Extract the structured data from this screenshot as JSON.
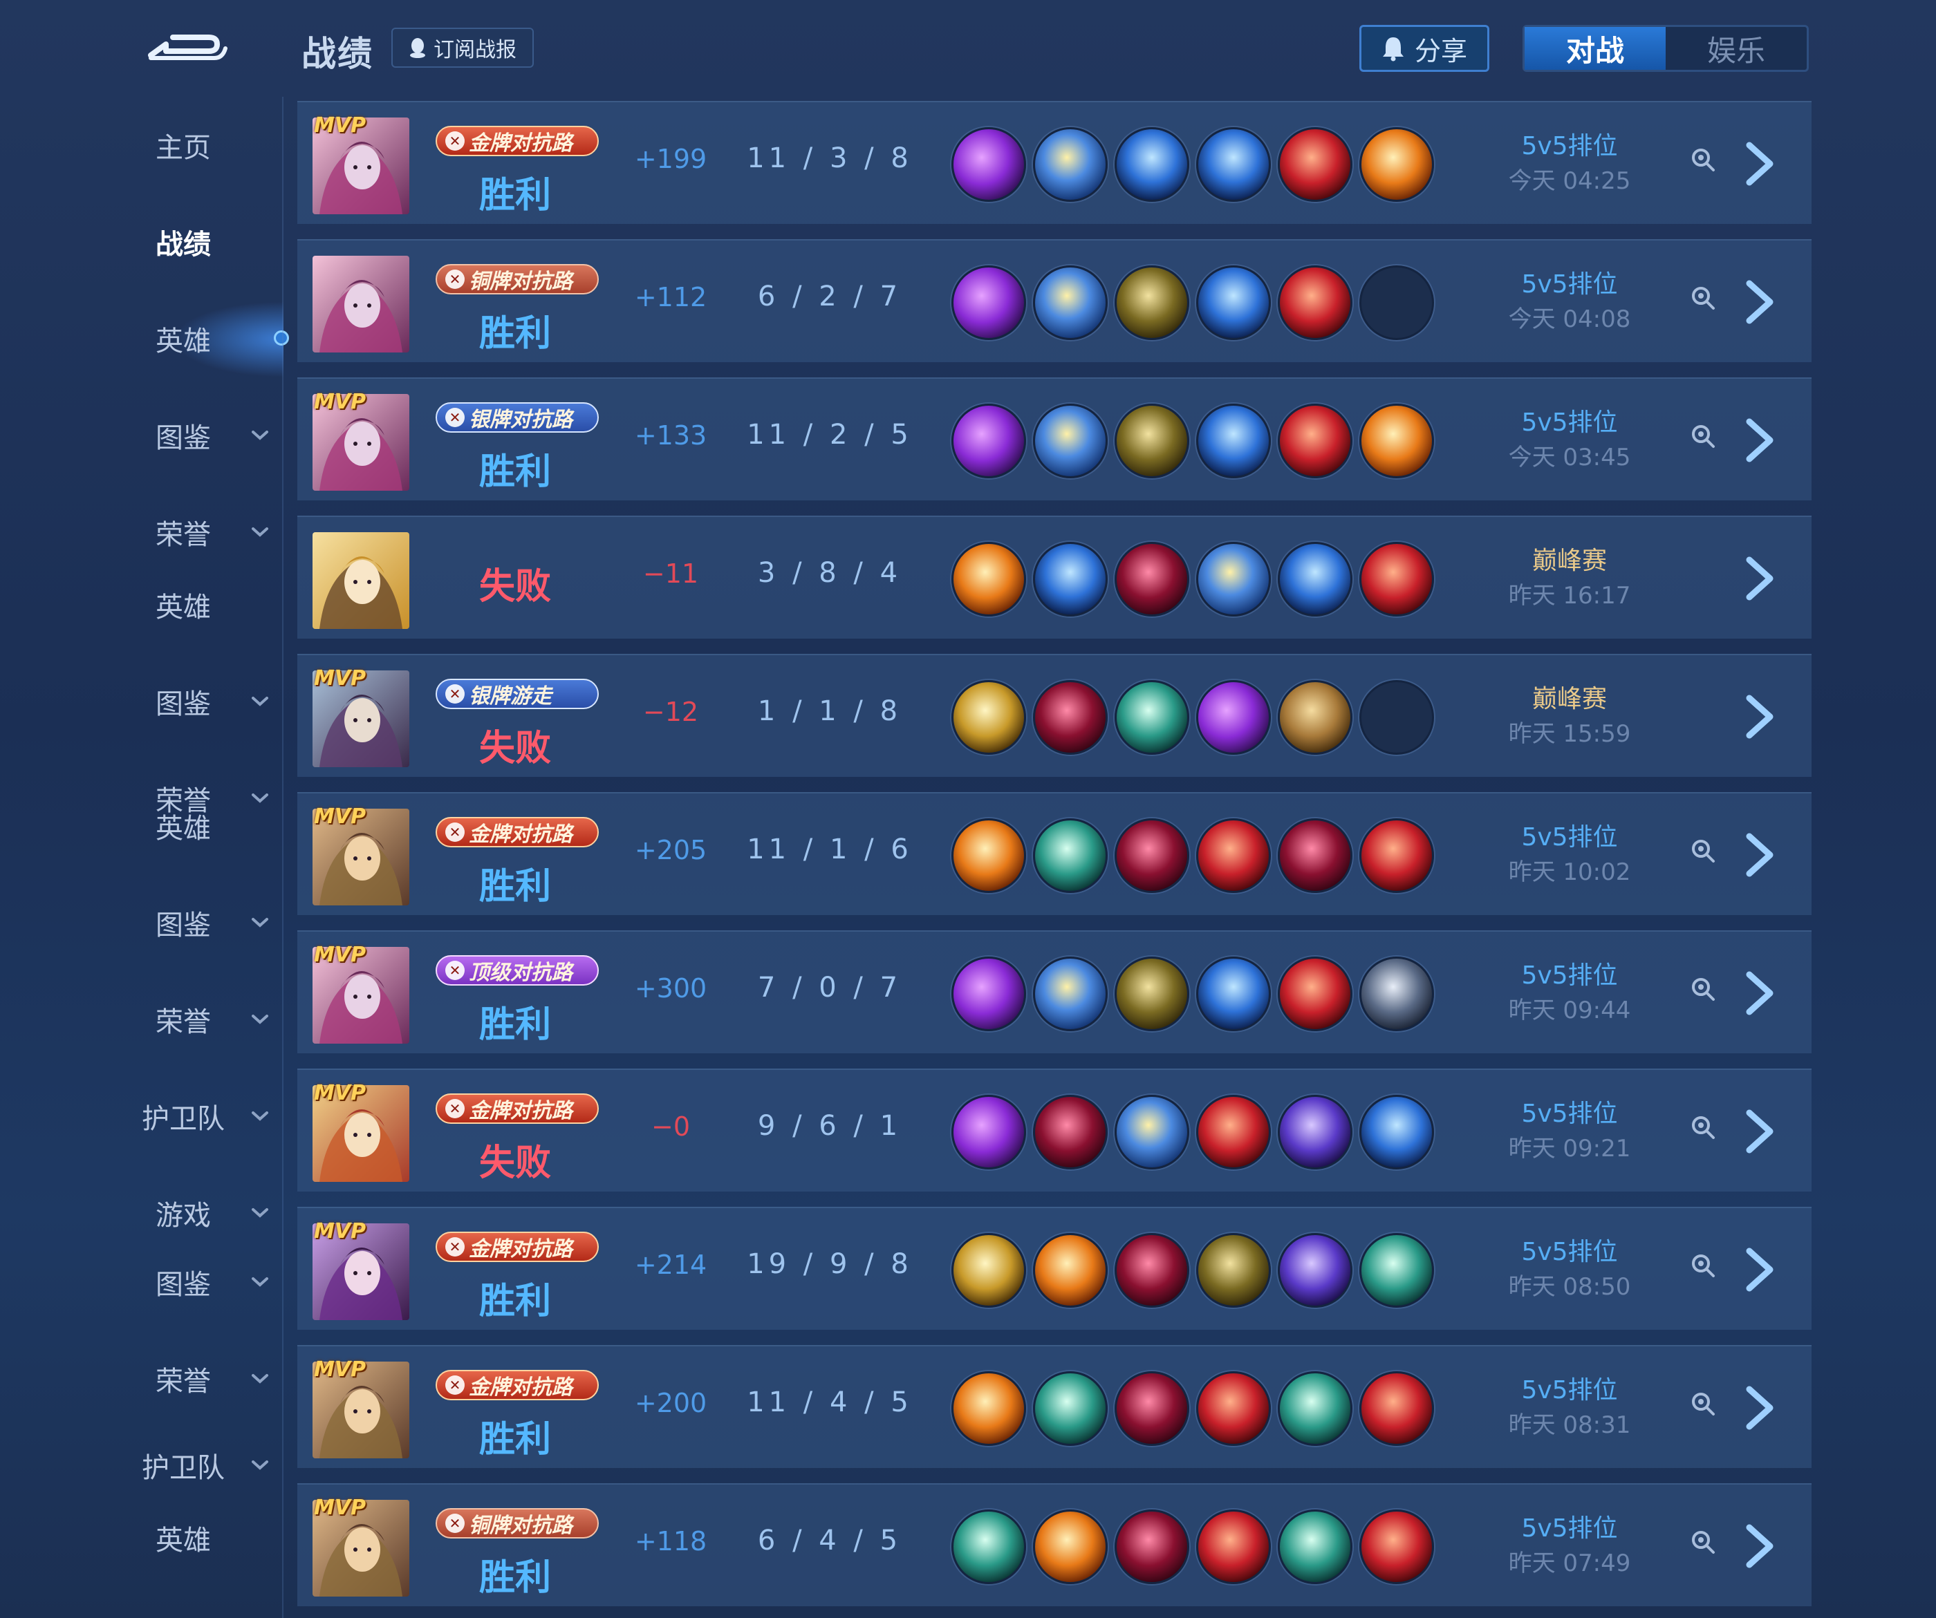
{
  "header": {
    "title": "战绩",
    "subscribe_label": "订阅战报",
    "share_label": "分享",
    "tabs": [
      {
        "label": "对战",
        "active": true
      },
      {
        "label": "娱乐",
        "active": false
      }
    ]
  },
  "sidebar": {
    "items": [
      {
        "label": "主页",
        "chevron": false,
        "active": false
      },
      {
        "label": "战绩",
        "chevron": false,
        "active": true
      },
      {
        "label": "英雄",
        "chevron": false,
        "active": false
      },
      {
        "label": "图鉴",
        "chevron": true,
        "active": false
      },
      {
        "label": "荣誉",
        "chevron": true,
        "active": false
      },
      {
        "label": "英雄",
        "chevron": false,
        "active": false
      },
      {
        "label": "图鉴",
        "chevron": true,
        "active": false
      },
      {
        "label": "荣誉",
        "chevron": true,
        "active": false
      },
      {
        "label": "英雄",
        "chevron": false,
        "active": false
      },
      {
        "label": "图鉴",
        "chevron": true,
        "active": false
      },
      {
        "label": "荣誉",
        "chevron": true,
        "active": false
      },
      {
        "label": "护卫队",
        "chevron": true,
        "active": false
      },
      {
        "label": "游戏",
        "chevron": true,
        "active": false
      },
      {
        "label": "图鉴",
        "chevron": true,
        "active": false
      },
      {
        "label": "荣誉",
        "chevron": true,
        "active": false
      },
      {
        "label": "护卫队",
        "chevron": true,
        "active": false
      },
      {
        "label": "英雄",
        "chevron": false,
        "active": false
      }
    ]
  },
  "matches": [
    {
      "mvp": true,
      "hero": "h1",
      "badge": "金牌对抗路",
      "badge_tier": "gold",
      "result": "胜利",
      "win": true,
      "delta": "+199",
      "kda": "11 / 3 / 8",
      "items": [
        "p-purple",
        "p-blue",
        "p-blue2",
        "p-blue2",
        "p-red",
        "p-orange"
      ],
      "mode": "5v5排位",
      "time": "今天 04:25",
      "spectate": true
    },
    {
      "mvp": false,
      "hero": "h1",
      "badge": "铜牌对抗路",
      "badge_tier": "copper",
      "result": "胜利",
      "win": true,
      "delta": "+112",
      "kda": "6 / 2 / 7",
      "items": [
        "p-purple",
        "p-blue",
        "p-green",
        "p-blue2",
        "p-red",
        "empty"
      ],
      "mode": "5v5排位",
      "time": "今天 04:08",
      "spectate": true
    },
    {
      "mvp": true,
      "hero": "h1",
      "badge": "银牌对抗路",
      "badge_tier": "silver",
      "result": "胜利",
      "win": true,
      "delta": "+133",
      "kda": "11 / 2 / 5",
      "items": [
        "p-purple",
        "p-blue",
        "p-green",
        "p-blue2",
        "p-red",
        "p-orange"
      ],
      "mode": "5v5排位",
      "time": "今天 03:45",
      "spectate": true
    },
    {
      "mvp": false,
      "hero": "h2",
      "badge": "",
      "badge_tier": "",
      "result": "失败",
      "win": false,
      "delta": "−11",
      "kda": "3 / 8 / 4",
      "items": [
        "p-orange",
        "p-blue2",
        "p-crimson",
        "p-blue",
        "p-blue2",
        "p-red"
      ],
      "mode": "巅峰赛",
      "time": "昨天 16:17",
      "spectate": false
    },
    {
      "mvp": true,
      "hero": "h3",
      "badge": "银牌游走",
      "badge_tier": "silver",
      "result": "失败",
      "win": false,
      "delta": "−12",
      "kda": "1 / 1 / 8",
      "items": [
        "p-gold",
        "p-crimson",
        "p-teal",
        "p-purple",
        "p-wood",
        "empty"
      ],
      "mode": "巅峰赛",
      "time": "昨天 15:59",
      "spectate": false
    },
    {
      "mvp": true,
      "hero": "h4",
      "badge": "金牌对抗路",
      "badge_tier": "gold",
      "result": "胜利",
      "win": true,
      "delta": "+205",
      "kda": "11 / 1 / 6",
      "items": [
        "p-orange",
        "p-teal",
        "p-crimson",
        "p-red",
        "p-crimson",
        "p-red"
      ],
      "mode": "5v5排位",
      "time": "昨天 10:02",
      "spectate": true
    },
    {
      "mvp": true,
      "hero": "h1",
      "badge": "顶级对抗路",
      "badge_tier": "top",
      "result": "胜利",
      "win": true,
      "delta": "+300",
      "kda": "7 / 0 / 7",
      "items": [
        "p-purple",
        "p-blue",
        "p-green",
        "p-blue2",
        "p-red",
        "p-steel"
      ],
      "mode": "5v5排位",
      "time": "昨天 09:44",
      "spectate": true
    },
    {
      "mvp": true,
      "hero": "h5",
      "badge": "金牌对抗路",
      "badge_tier": "gold",
      "result": "失败",
      "win": false,
      "delta": "−0",
      "kda": "9 / 6 / 1",
      "items": [
        "p-purple",
        "p-crimson",
        "p-blue",
        "p-red",
        "p-violet",
        "p-blue2"
      ],
      "mode": "5v5排位",
      "time": "昨天 09:21",
      "spectate": true
    },
    {
      "mvp": true,
      "hero": "h6",
      "badge": "金牌对抗路",
      "badge_tier": "gold",
      "result": "胜利",
      "win": true,
      "delta": "+214",
      "kda": "19 / 9 / 8",
      "items": [
        "p-gold",
        "p-orange",
        "p-crimson",
        "p-green",
        "p-violet",
        "p-teal"
      ],
      "mode": "5v5排位",
      "time": "昨天 08:50",
      "spectate": true
    },
    {
      "mvp": true,
      "hero": "h4",
      "badge": "金牌对抗路",
      "badge_tier": "gold",
      "result": "胜利",
      "win": true,
      "delta": "+200",
      "kda": "11 / 4 / 5",
      "items": [
        "p-orange",
        "p-teal",
        "p-crimson",
        "p-red",
        "p-teal",
        "p-red"
      ],
      "mode": "5v5排位",
      "time": "昨天 08:31",
      "spectate": true
    },
    {
      "mvp": true,
      "hero": "h4",
      "badge": "铜牌对抗路",
      "badge_tier": "copper",
      "result": "胜利",
      "win": true,
      "delta": "+118",
      "kda": "6 / 4 / 5",
      "items": [
        "p-teal",
        "p-orange",
        "p-crimson",
        "p-red",
        "p-teal",
        "p-red"
      ],
      "mode": "5v5排位",
      "time": "昨天 07:49",
      "spectate": true
    }
  ],
  "colors": {
    "win": "#54b8ff",
    "lose": "#ff5a6b",
    "accent": "#2a7ad8"
  },
  "icons": [
    "back-icon",
    "bell-icon",
    "qq-icon",
    "chevron-down-icon",
    "spectate-icon",
    "chevron-right-icon"
  ]
}
